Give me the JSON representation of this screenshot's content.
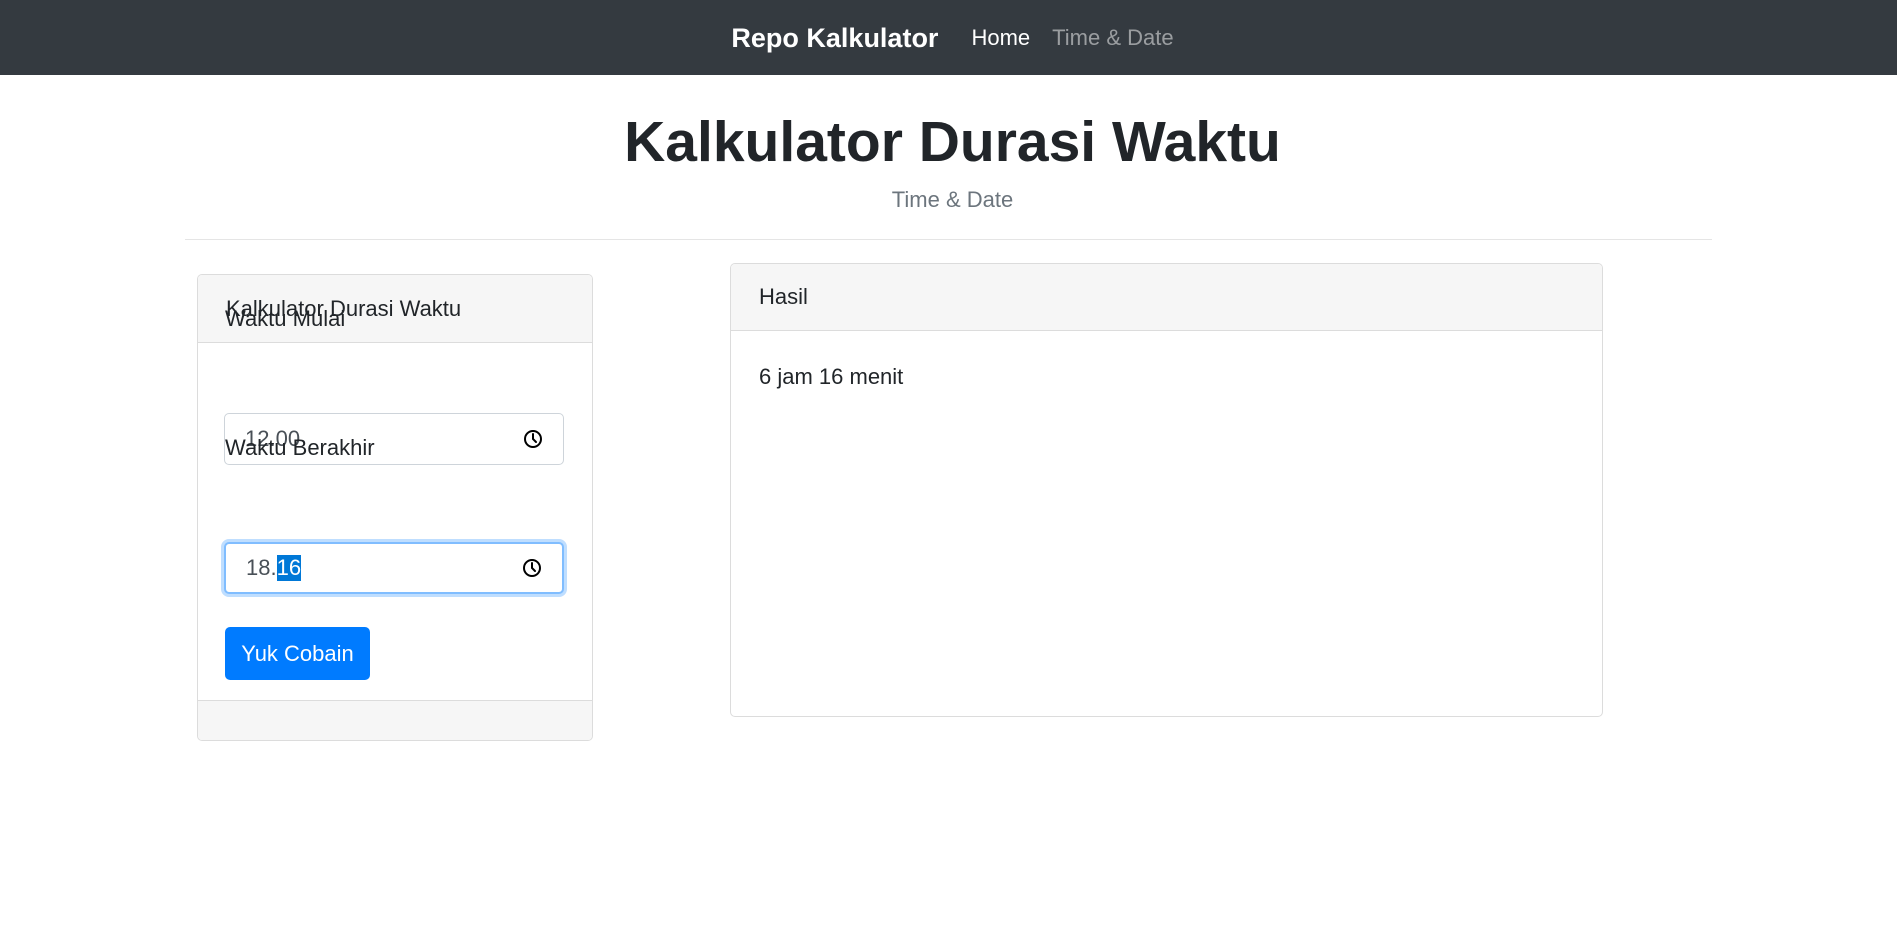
{
  "navbar": {
    "brand": "Repo Kalkulator",
    "links": [
      {
        "label": "Home",
        "active": true
      },
      {
        "label": "Time & Date",
        "active": false
      }
    ]
  },
  "hero": {
    "title": "Kalkulator Durasi Waktu",
    "subtitle": "Time & Date"
  },
  "calculator": {
    "header": "Kalkulator Durasi Waktu",
    "start_label": "Waktu Mulai",
    "start_value": "12.00",
    "end_label": "Waktu Berakhir",
    "end_value_hour": "18.",
    "end_value_minute_selected": "16",
    "submit_label": "Yuk Cobain"
  },
  "result": {
    "header": "Hasil",
    "text": "6 jam 16 menit"
  },
  "colors": {
    "navbar": "#343a40",
    "primary": "#007bff",
    "focus_ring": "#80bdff",
    "selection": "#0078d7"
  }
}
